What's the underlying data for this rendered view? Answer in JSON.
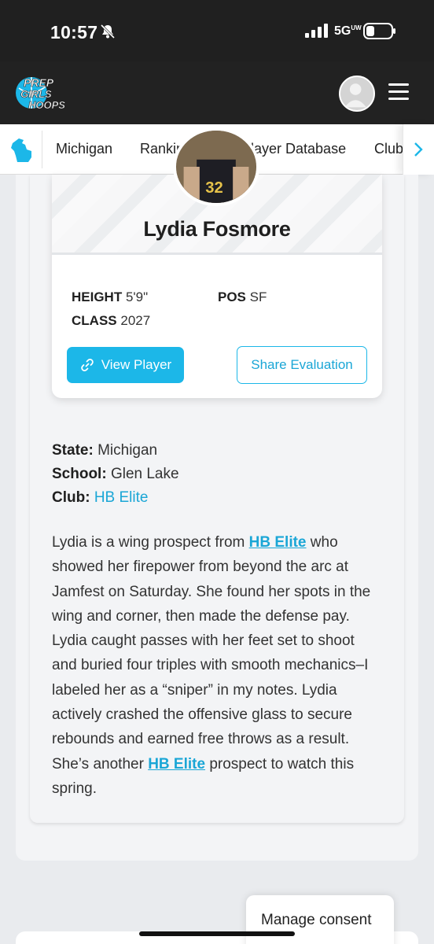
{
  "status_bar": {
    "time": "10:57",
    "network": "5G",
    "network_suffix": "UW"
  },
  "header": {
    "logo_text": [
      "PREP",
      "GIRLS",
      "HOOPS"
    ],
    "colors": {
      "background": "#222222",
      "accent": "#1cb7e8"
    }
  },
  "nav": {
    "items": [
      {
        "label": "Michigan"
      },
      {
        "label": "Rankings"
      },
      {
        "label": "Player Database"
      },
      {
        "label": "Club"
      }
    ]
  },
  "player": {
    "name": "Lydia Fosmore",
    "jersey": "32",
    "height_label": "HEIGHT",
    "height": "5'9\"",
    "pos_label": "POS",
    "pos": "SF",
    "class_label": "CLASS",
    "class": "2027",
    "view_button": "View Player",
    "share_button": "Share Evaluation"
  },
  "meta": {
    "state_label": "State:",
    "state": "Michigan",
    "school_label": "School:",
    "school": "Glen Lake",
    "club_label": "Club:",
    "club": "HB Elite"
  },
  "evaluation": {
    "p1": "Lydia is a wing prospect from ",
    "link1": "HB Elite",
    "p2": " who showed her firepower from beyond the arc at Jamfest on Saturday. She found her spots in the wing and corner, then made the defense pay. Lydia caught passes with her feet set to shoot and buried four triples with smooth mechanics–I labeled her as a “sniper” in my notes. Lydia actively crashed the offensive glass to secure rebounds and earned free throws as a result. She’s another ",
    "link2": "HB Elite",
    "p3": " prospect to watch this spring."
  },
  "consent": {
    "label": "Manage consent"
  }
}
